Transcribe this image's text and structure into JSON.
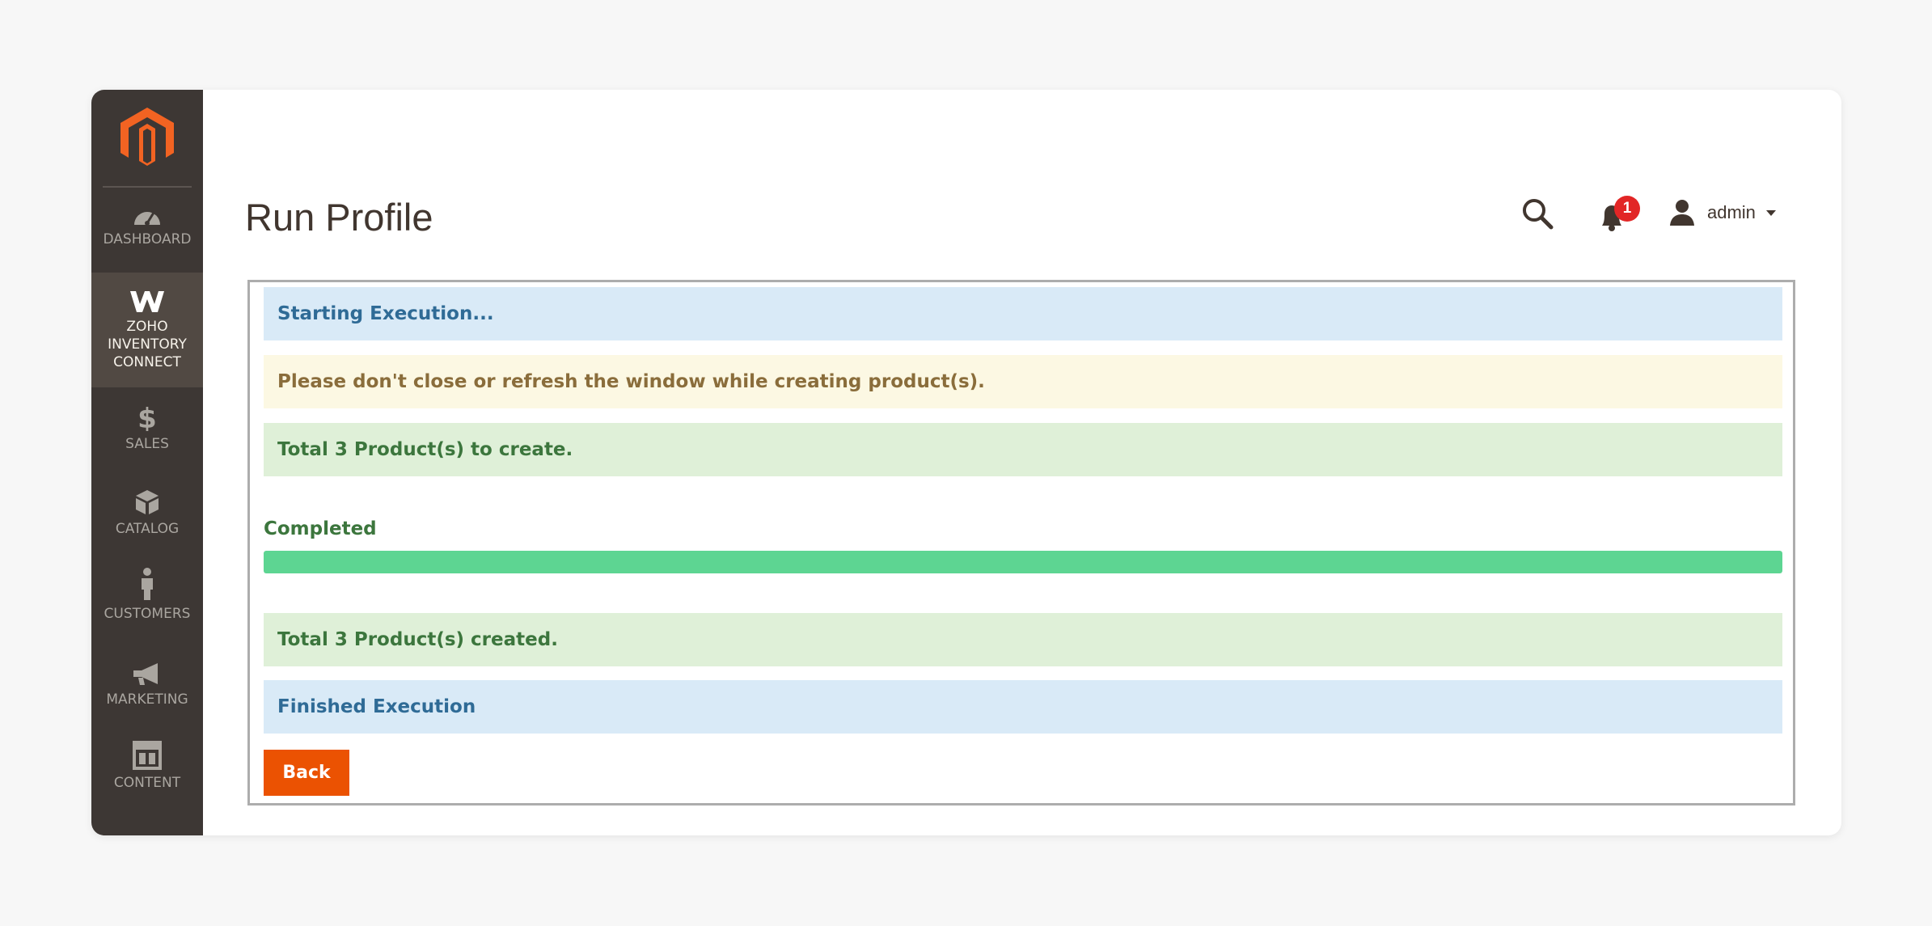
{
  "sidebar": {
    "items": [
      {
        "label": "DASHBOARD",
        "icon": "dashboard-icon"
      },
      {
        "label": "ZOHO INVENTORY CONNECT",
        "icon": "zoho-icon"
      },
      {
        "label": "SALES",
        "icon": "dollar-icon"
      },
      {
        "label": "CATALOG",
        "icon": "box-icon"
      },
      {
        "label": "CUSTOMERS",
        "icon": "person-icon"
      },
      {
        "label": "MARKETING",
        "icon": "megaphone-icon"
      },
      {
        "label": "CONTENT",
        "icon": "layout-icon"
      }
    ],
    "active": "ZOHO INVENTORY CONNECT"
  },
  "header": {
    "title": "Run Profile",
    "notifications_count": "1",
    "user_name": "admin"
  },
  "messages": [
    {
      "type": "info",
      "text": "Starting Execution..."
    },
    {
      "type": "warning",
      "text": "Please don't close or refresh the window while creating product(s)."
    },
    {
      "type": "success",
      "text": "Total 3 Product(s) to create."
    }
  ],
  "progress": {
    "label": "Completed",
    "value": 1.0
  },
  "results": [
    {
      "type": "success",
      "text": "Total 3 Product(s) created."
    },
    {
      "type": "info",
      "text": "Finished Execution"
    }
  ],
  "actions": {
    "back_label": "Back"
  },
  "colors": {
    "accent": "#eb5202",
    "sidebar_bg": "#3d3734",
    "progress": "#5dd592",
    "badge": "#e22626"
  }
}
